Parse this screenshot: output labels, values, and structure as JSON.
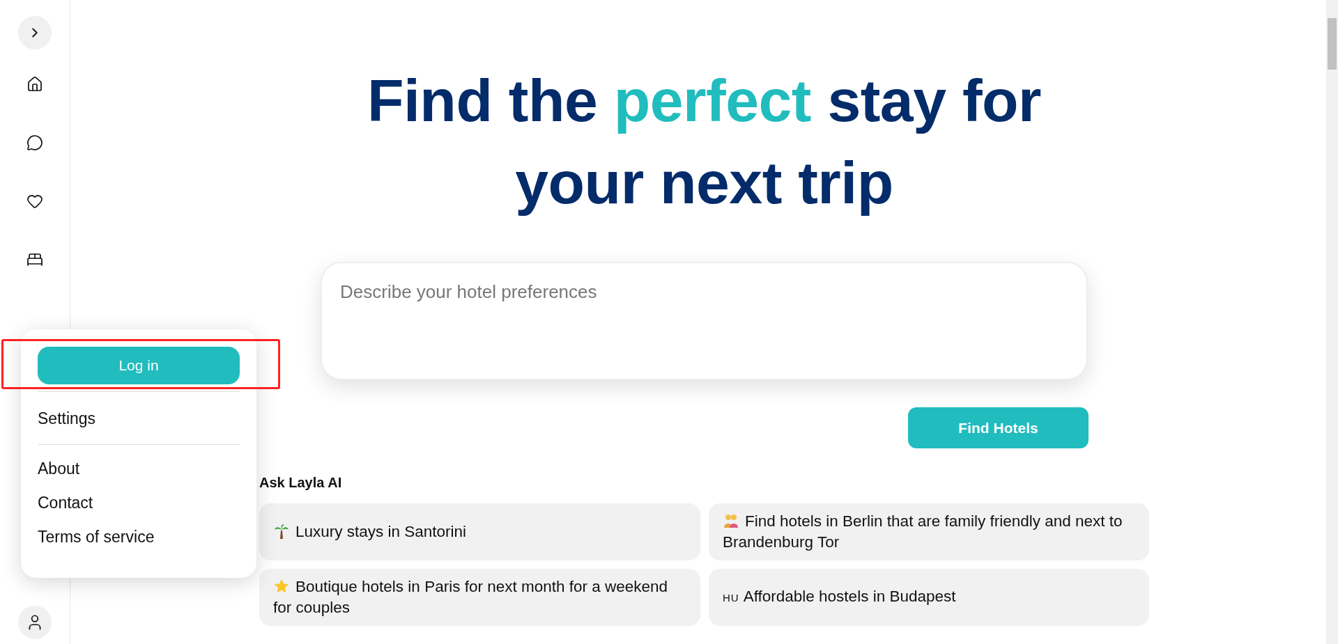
{
  "sidebar": {
    "items": [
      {
        "kind": "home"
      },
      {
        "kind": "chat"
      },
      {
        "kind": "heart"
      },
      {
        "kind": "bed"
      }
    ]
  },
  "menu": {
    "login_button": "Log in",
    "top_items": [
      "Settings"
    ],
    "bottom_items": [
      "About",
      "Contact",
      "Terms of service"
    ]
  },
  "headline": {
    "before": "Find the ",
    "accent": "perfect",
    "after": " stay for",
    "line2": "your next trip"
  },
  "search": {
    "placeholder": "Describe your hotel preferences"
  },
  "find_button": "Find Hotels",
  "suggestions": {
    "title": "Ask Layla AI",
    "items": [
      {
        "kind": "palm",
        "text": "Luxury stays in Santorini"
      },
      {
        "kind": "couple",
        "text": "Find hotels in Berlin that are family friendly and next to Brandenburg Tor"
      },
      {
        "kind": "star",
        "text": "Boutique hotels in Paris for next month for a weekend for couples"
      },
      {
        "kind": "code",
        "badge": "HU",
        "text": "Affordable hostels in Budapest"
      }
    ]
  }
}
